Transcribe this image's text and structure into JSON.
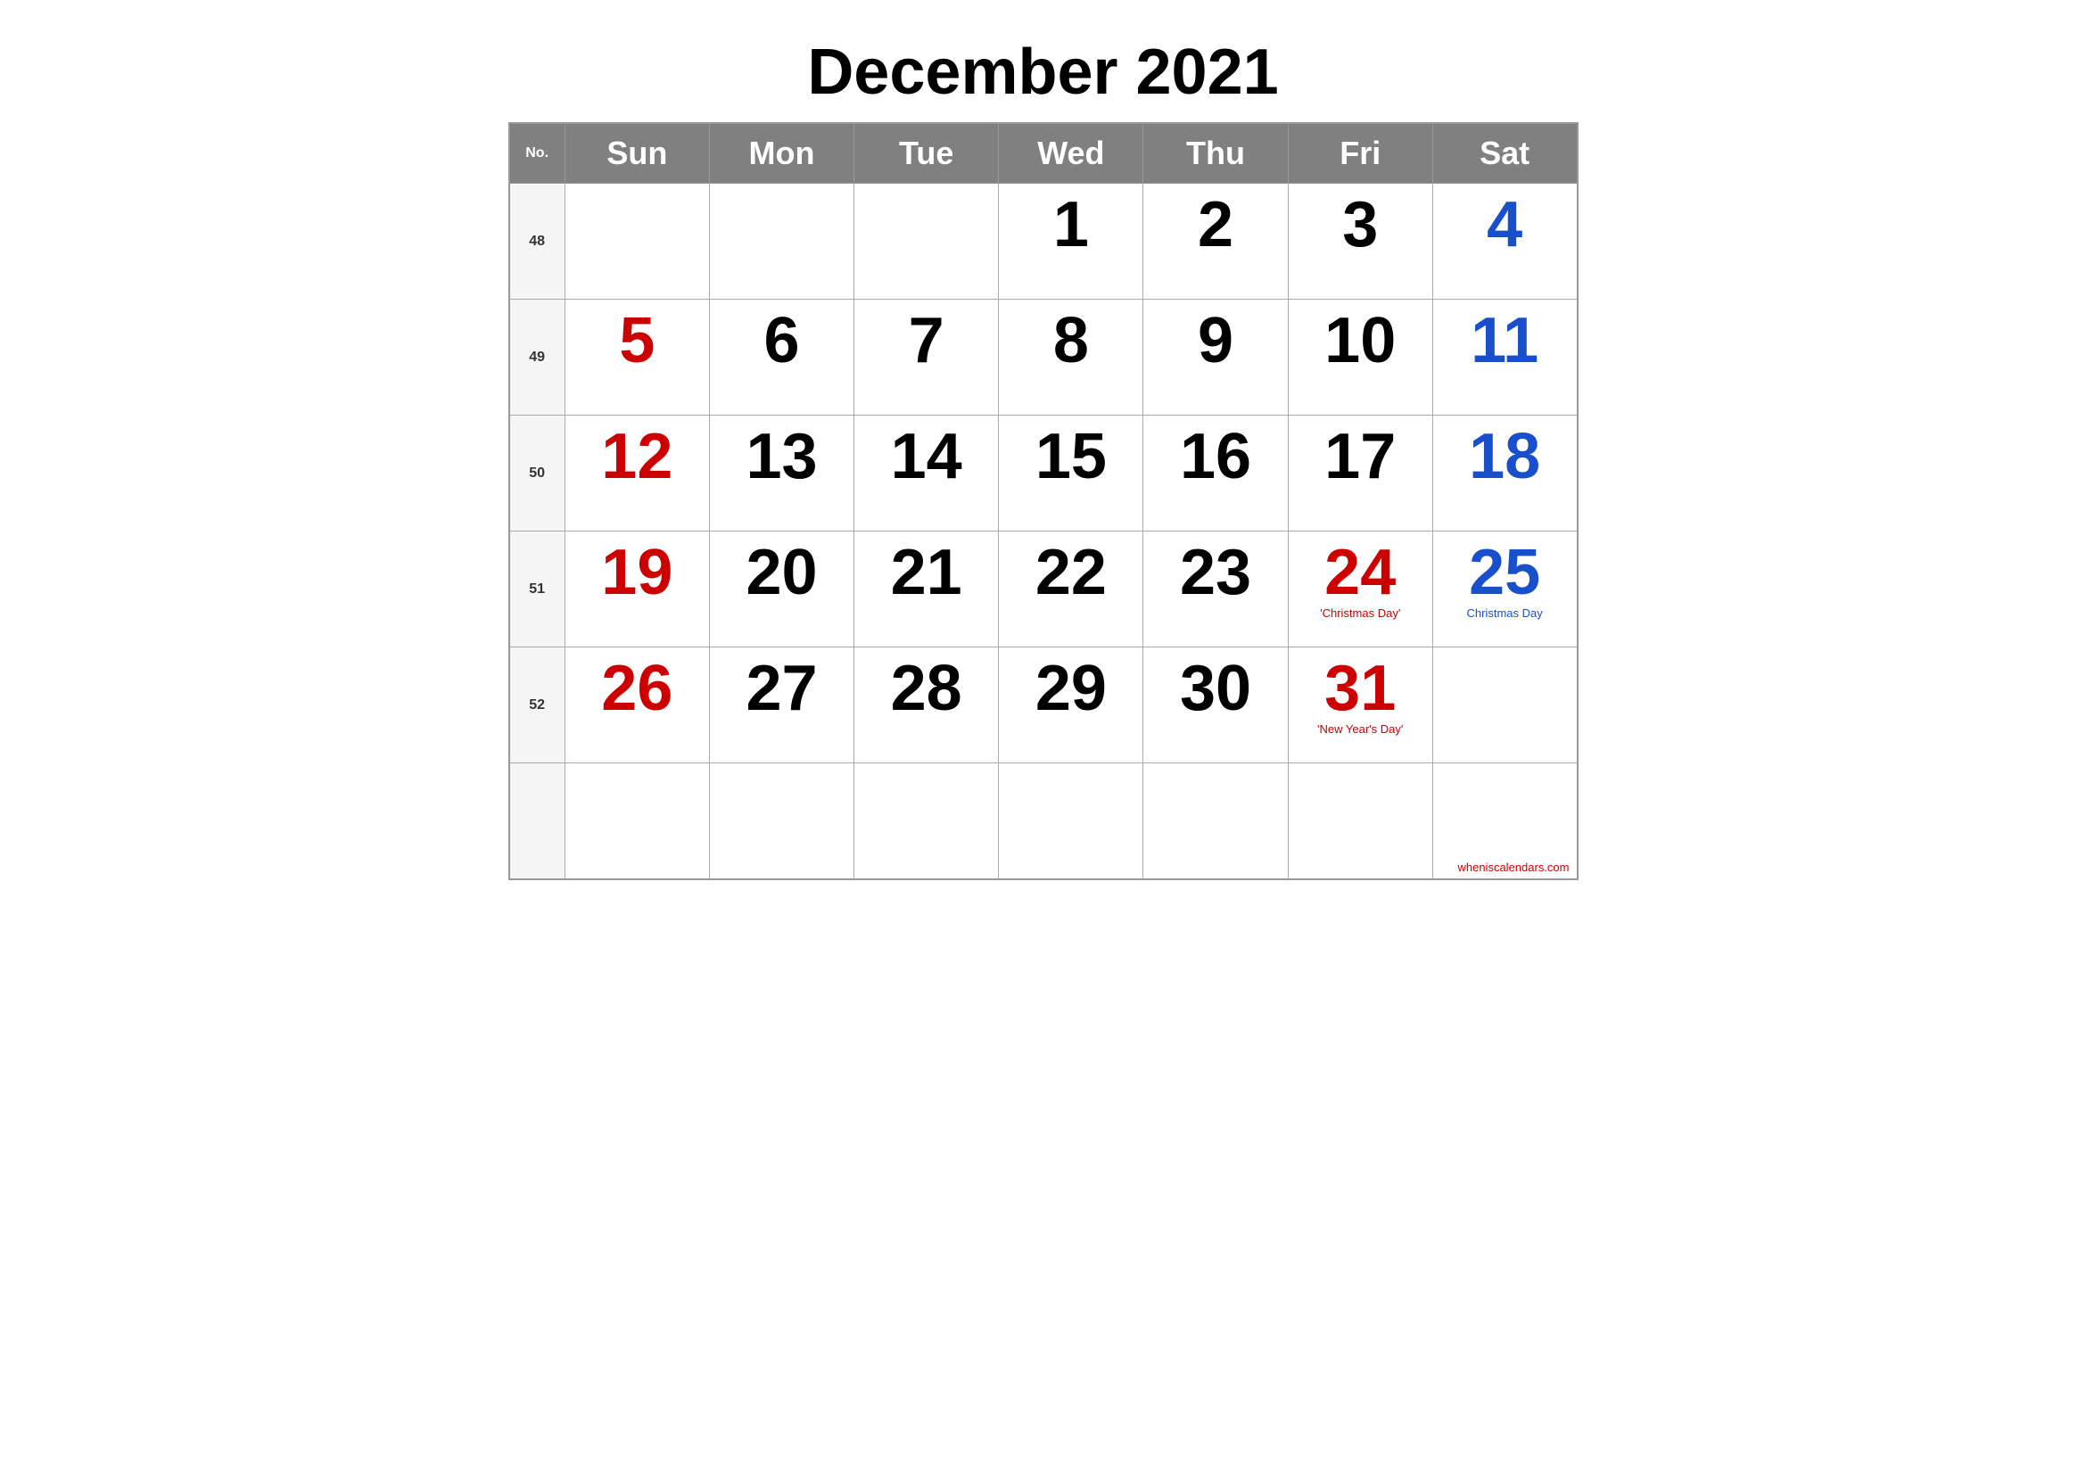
{
  "calendar": {
    "title": "December 2021",
    "headers": {
      "no": "No.",
      "sun": "Sun",
      "mon": "Mon",
      "tue": "Tue",
      "wed": "Wed",
      "thu": "Thu",
      "fri": "Fri",
      "sat": "Sat"
    },
    "weeks": [
      {
        "week_num": "48",
        "days": [
          {
            "date": "",
            "color": "black"
          },
          {
            "date": "",
            "color": "black"
          },
          {
            "date": "",
            "color": "black"
          },
          {
            "date": "1",
            "color": "black"
          },
          {
            "date": "2",
            "color": "black"
          },
          {
            "date": "3",
            "color": "black"
          },
          {
            "date": "4",
            "color": "blue"
          }
        ]
      },
      {
        "week_num": "49",
        "days": [
          {
            "date": "5",
            "color": "red"
          },
          {
            "date": "6",
            "color": "black"
          },
          {
            "date": "7",
            "color": "black"
          },
          {
            "date": "8",
            "color": "black"
          },
          {
            "date": "9",
            "color": "black"
          },
          {
            "date": "10",
            "color": "black"
          },
          {
            "date": "11",
            "color": "blue"
          }
        ]
      },
      {
        "week_num": "50",
        "days": [
          {
            "date": "12",
            "color": "red"
          },
          {
            "date": "13",
            "color": "black"
          },
          {
            "date": "14",
            "color": "black"
          },
          {
            "date": "15",
            "color": "black"
          },
          {
            "date": "16",
            "color": "black"
          },
          {
            "date": "17",
            "color": "black"
          },
          {
            "date": "18",
            "color": "blue"
          }
        ]
      },
      {
        "week_num": "51",
        "days": [
          {
            "date": "19",
            "color": "red"
          },
          {
            "date": "20",
            "color": "black"
          },
          {
            "date": "21",
            "color": "black"
          },
          {
            "date": "22",
            "color": "black"
          },
          {
            "date": "23",
            "color": "black"
          },
          {
            "date": "24",
            "color": "red",
            "holiday": "'Christmas Day'"
          },
          {
            "date": "25",
            "color": "blue",
            "holiday": "Christmas Day"
          }
        ]
      },
      {
        "week_num": "52",
        "days": [
          {
            "date": "26",
            "color": "red"
          },
          {
            "date": "27",
            "color": "black"
          },
          {
            "date": "28",
            "color": "black"
          },
          {
            "date": "29",
            "color": "black"
          },
          {
            "date": "30",
            "color": "black"
          },
          {
            "date": "31",
            "color": "red",
            "holiday": "'New Year's Day'"
          },
          {
            "date": "",
            "color": "black"
          }
        ]
      },
      {
        "week_num": "",
        "days": [
          {
            "date": "",
            "color": "black"
          },
          {
            "date": "",
            "color": "black"
          },
          {
            "date": "",
            "color": "black"
          },
          {
            "date": "",
            "color": "black"
          },
          {
            "date": "",
            "color": "black"
          },
          {
            "date": "",
            "color": "black"
          },
          {
            "date": "",
            "color": "black",
            "watermark": "wheniscalendars.com"
          }
        ]
      }
    ]
  }
}
